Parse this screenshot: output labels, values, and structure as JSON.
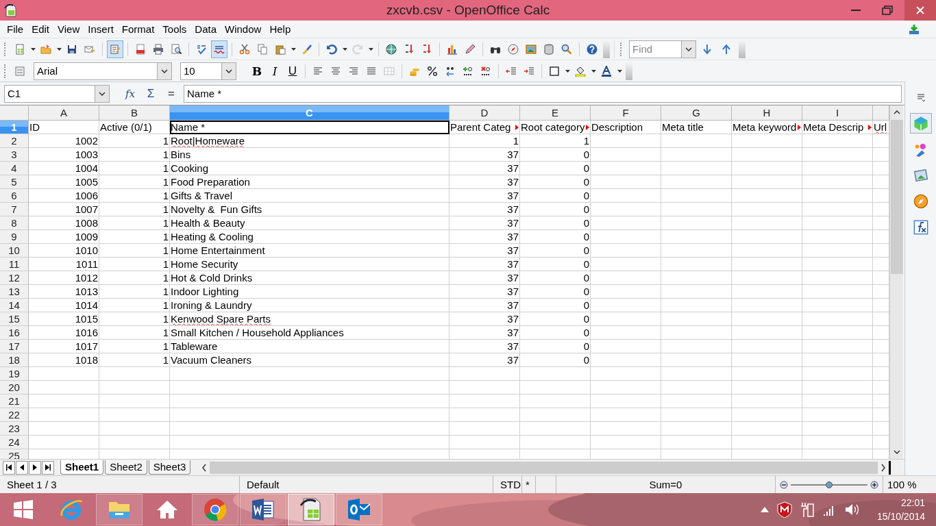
{
  "window": {
    "title": "zxcvb.csv - OpenOffice Calc"
  },
  "menu": [
    "File",
    "Edit",
    "View",
    "Insert",
    "Format",
    "Tools",
    "Data",
    "Window",
    "Help"
  ],
  "standard_toolbar": {
    "edit_mode": true,
    "auto_spellcheck": true,
    "redo_disabled": true
  },
  "find_toolbar": {
    "placeholder": "Find"
  },
  "formatting_toolbar": {
    "font_name": "Arial",
    "font_size": "10",
    "style_buttons": [
      "B",
      "I",
      "U"
    ]
  },
  "formula_bar": {
    "name_box": "C1",
    "buttons": [
      "fx",
      "Σ",
      "="
    ],
    "formula": "Name *"
  },
  "sheet": {
    "columns": [
      {
        "label": "A",
        "selected": false
      },
      {
        "label": "B",
        "selected": false
      },
      {
        "label": "C",
        "selected": true
      },
      {
        "label": "D",
        "selected": false
      },
      {
        "label": "E",
        "selected": false
      },
      {
        "label": "F",
        "selected": false
      },
      {
        "label": "G",
        "selected": false
      },
      {
        "label": "H",
        "selected": false
      },
      {
        "label": "I",
        "selected": false
      }
    ],
    "rows": [
      {
        "number": "1",
        "selected": true,
        "cells": [
          {
            "text": "ID",
            "kind": "text"
          },
          {
            "text": "Active (0/1)",
            "kind": "text"
          },
          {
            "text": "Name *",
            "kind": "text"
          },
          {
            "text": "Parent Categ",
            "kind": "overflow"
          },
          {
            "text": "Root category",
            "kind": "overflow"
          },
          {
            "text": "Description",
            "kind": "text"
          },
          {
            "text": "Meta title",
            "kind": "text"
          },
          {
            "text": "Meta keyword",
            "kind": "overflow"
          },
          {
            "text": "Meta Descrip",
            "kind": "overflow"
          },
          {
            "text": "Url",
            "kind": "misspelled"
          }
        ]
      },
      {
        "number": "2",
        "selected": false,
        "cells": [
          {
            "text": "1002",
            "kind": "number"
          },
          {
            "text": "1",
            "kind": "number"
          },
          {
            "text": "Root|Homeware",
            "kind": "misspelled"
          },
          {
            "text": "1",
            "kind": "number"
          },
          {
            "text": "1",
            "kind": "number"
          }
        ]
      },
      {
        "number": "3",
        "selected": false,
        "cells": [
          {
            "text": "1003",
            "kind": "number"
          },
          {
            "text": "1",
            "kind": "number"
          },
          {
            "text": "Bins",
            "kind": "text"
          },
          {
            "text": "37",
            "kind": "number"
          },
          {
            "text": "0",
            "kind": "number"
          }
        ]
      },
      {
        "number": "4",
        "selected": false,
        "cells": [
          {
            "text": "1004",
            "kind": "number"
          },
          {
            "text": "1",
            "kind": "number"
          },
          {
            "text": "Cooking",
            "kind": "text"
          },
          {
            "text": "37",
            "kind": "number"
          },
          {
            "text": "0",
            "kind": "number"
          }
        ]
      },
      {
        "number": "5",
        "selected": false,
        "cells": [
          {
            "text": "1005",
            "kind": "number"
          },
          {
            "text": "1",
            "kind": "number"
          },
          {
            "text": "Food Preparation",
            "kind": "text"
          },
          {
            "text": "37",
            "kind": "number"
          },
          {
            "text": "0",
            "kind": "number"
          }
        ]
      },
      {
        "number": "6",
        "selected": false,
        "cells": [
          {
            "text": "1006",
            "kind": "number"
          },
          {
            "text": "1",
            "kind": "number"
          },
          {
            "text": "Gifts & Travel",
            "kind": "text"
          },
          {
            "text": "37",
            "kind": "number"
          },
          {
            "text": "0",
            "kind": "number"
          }
        ]
      },
      {
        "number": "7",
        "selected": false,
        "cells": [
          {
            "text": "1007",
            "kind": "number"
          },
          {
            "text": "1",
            "kind": "number"
          },
          {
            "text": "Novelty &  Fun Gifts",
            "kind": "text"
          },
          {
            "text": "37",
            "kind": "number"
          },
          {
            "text": "0",
            "kind": "number"
          }
        ]
      },
      {
        "number": "8",
        "selected": false,
        "cells": [
          {
            "text": "1008",
            "kind": "number"
          },
          {
            "text": "1",
            "kind": "number"
          },
          {
            "text": "Health & Beauty",
            "kind": "text"
          },
          {
            "text": "37",
            "kind": "number"
          },
          {
            "text": "0",
            "kind": "number"
          }
        ]
      },
      {
        "number": "9",
        "selected": false,
        "cells": [
          {
            "text": "1009",
            "kind": "number"
          },
          {
            "text": "1",
            "kind": "number"
          },
          {
            "text": "Heating & Cooling",
            "kind": "text"
          },
          {
            "text": "37",
            "kind": "number"
          },
          {
            "text": "0",
            "kind": "number"
          }
        ]
      },
      {
        "number": "10",
        "selected": false,
        "cells": [
          {
            "text": "1010",
            "kind": "number"
          },
          {
            "text": "1",
            "kind": "number"
          },
          {
            "text": "Home Entertainment",
            "kind": "text"
          },
          {
            "text": "37",
            "kind": "number"
          },
          {
            "text": "0",
            "kind": "number"
          }
        ]
      },
      {
        "number": "11",
        "selected": false,
        "cells": [
          {
            "text": "1011",
            "kind": "number"
          },
          {
            "text": "1",
            "kind": "number"
          },
          {
            "text": "Home Security",
            "kind": "text"
          },
          {
            "text": "37",
            "kind": "number"
          },
          {
            "text": "0",
            "kind": "number"
          }
        ]
      },
      {
        "number": "12",
        "selected": false,
        "cells": [
          {
            "text": "1012",
            "kind": "number"
          },
          {
            "text": "1",
            "kind": "number"
          },
          {
            "text": "Hot & Cold Drinks",
            "kind": "text"
          },
          {
            "text": "37",
            "kind": "number"
          },
          {
            "text": "0",
            "kind": "number"
          }
        ]
      },
      {
        "number": "13",
        "selected": false,
        "cells": [
          {
            "text": "1013",
            "kind": "number"
          },
          {
            "text": "1",
            "kind": "number"
          },
          {
            "text": "Indoor Lighting",
            "kind": "text"
          },
          {
            "text": "37",
            "kind": "number"
          },
          {
            "text": "0",
            "kind": "number"
          }
        ]
      },
      {
        "number": "14",
        "selected": false,
        "cells": [
          {
            "text": "1014",
            "kind": "number"
          },
          {
            "text": "1",
            "kind": "number"
          },
          {
            "text": "Ironing & Laundry",
            "kind": "text"
          },
          {
            "text": "37",
            "kind": "number"
          },
          {
            "text": "0",
            "kind": "number"
          }
        ]
      },
      {
        "number": "15",
        "selected": false,
        "cells": [
          {
            "text": "1015",
            "kind": "number"
          },
          {
            "text": "1",
            "kind": "number"
          },
          {
            "text": "Kenwood Spare Parts",
            "kind": "misspelled"
          },
          {
            "text": "37",
            "kind": "number"
          },
          {
            "text": "0",
            "kind": "number"
          }
        ]
      },
      {
        "number": "16",
        "selected": false,
        "cells": [
          {
            "text": "1016",
            "kind": "number"
          },
          {
            "text": "1",
            "kind": "number"
          },
          {
            "text": "Small Kitchen / Household Appliances",
            "kind": "text"
          },
          {
            "text": "37",
            "kind": "number"
          },
          {
            "text": "0",
            "kind": "number"
          }
        ]
      },
      {
        "number": "17",
        "selected": false,
        "cells": [
          {
            "text": "1017",
            "kind": "number"
          },
          {
            "text": "1",
            "kind": "number"
          },
          {
            "text": "Tableware",
            "kind": "text"
          },
          {
            "text": "37",
            "kind": "number"
          },
          {
            "text": "0",
            "kind": "number"
          }
        ]
      },
      {
        "number": "18",
        "selected": false,
        "cells": [
          {
            "text": "1018",
            "kind": "number"
          },
          {
            "text": "1",
            "kind": "number"
          },
          {
            "text": "Vacuum Cleaners",
            "kind": "text"
          },
          {
            "text": "37",
            "kind": "number"
          },
          {
            "text": "0",
            "kind": "number"
          }
        ]
      },
      {
        "number": "19",
        "selected": false,
        "cells": []
      },
      {
        "number": "20",
        "selected": false,
        "cells": []
      },
      {
        "number": "21",
        "selected": false,
        "cells": []
      },
      {
        "number": "22",
        "selected": false,
        "cells": []
      },
      {
        "number": "23",
        "selected": false,
        "cells": []
      },
      {
        "number": "24",
        "selected": false,
        "cells": []
      },
      {
        "number": "25",
        "selected": false,
        "cells": []
      }
    ]
  },
  "sheet_tabs": [
    {
      "label": "Sheet1",
      "selected": true
    },
    {
      "label": "Sheet2",
      "selected": false
    },
    {
      "label": "Sheet3",
      "selected": false
    }
  ],
  "status_bar": {
    "sheet": "Sheet 1 / 3",
    "page_style": "Default",
    "mode": "STD",
    "modified": "*",
    "sum": "Sum=0",
    "zoom": {
      "level": 0.5
    },
    "zoom_text": "100 %"
  },
  "taskbar": {
    "apps": [
      {
        "kind": "ie",
        "running": false,
        "selected": false
      },
      {
        "kind": "explorer",
        "running": true,
        "selected": false
      },
      {
        "kind": "home",
        "running": false,
        "selected": false
      },
      {
        "kind": "chrome",
        "running": true,
        "selected": false
      },
      {
        "kind": "word",
        "running": true,
        "selected": false
      },
      {
        "kind": "calc",
        "running": true,
        "selected": true
      },
      {
        "kind": "outlook",
        "running": true,
        "selected": false
      }
    ],
    "time": "22:01",
    "date": "15/10/2014"
  }
}
